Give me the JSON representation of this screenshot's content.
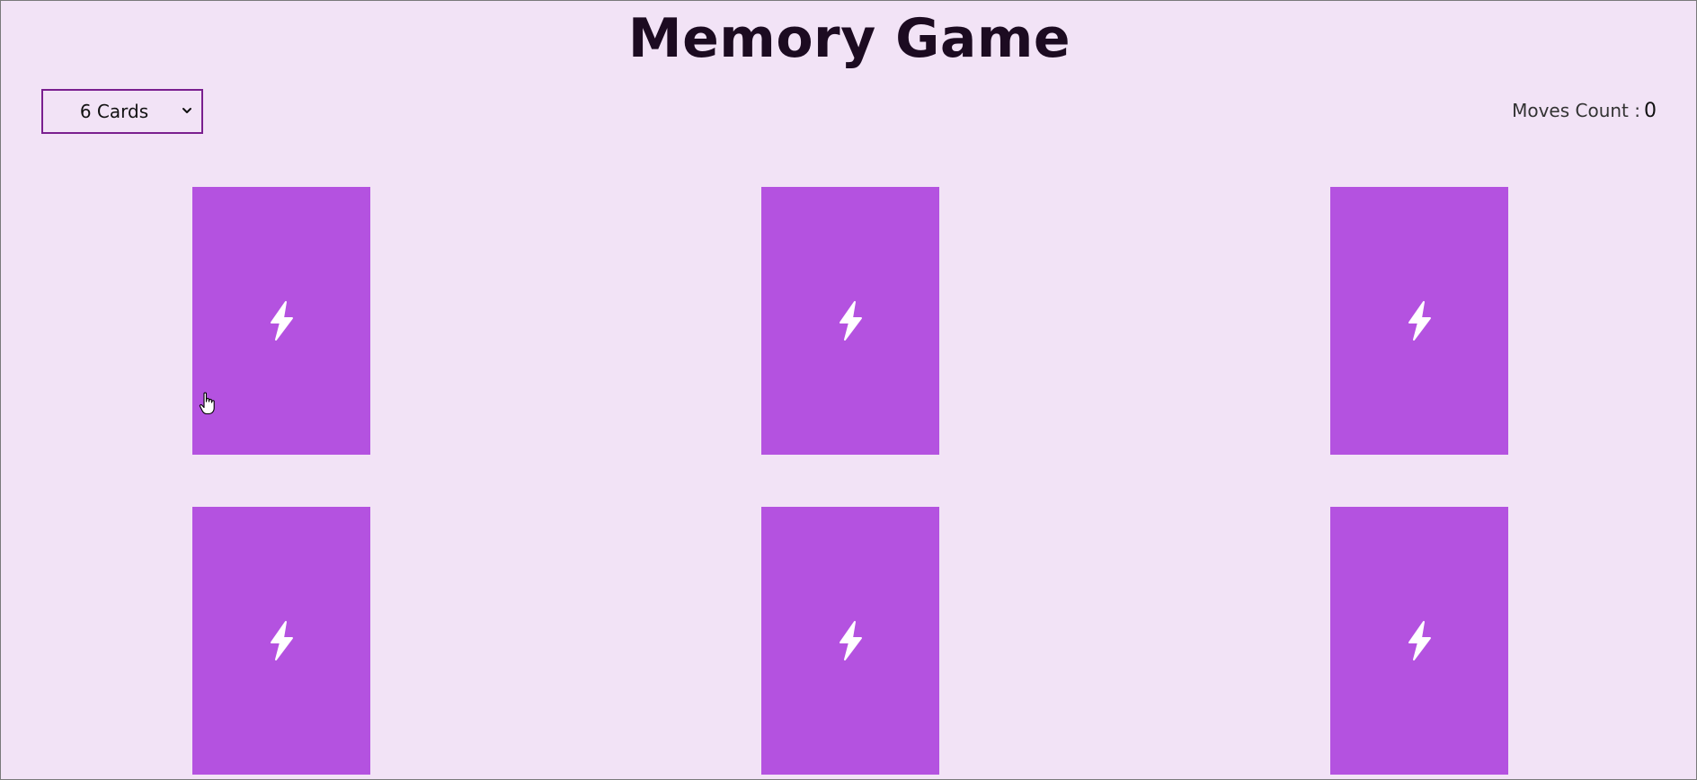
{
  "title": "Memory Game",
  "card_count_select": {
    "selected": "6 Cards"
  },
  "moves": {
    "label": "Moves Count :",
    "value": "0"
  },
  "cards": [
    {
      "state": "face-down",
      "icon": "lightning-bolt-icon"
    },
    {
      "state": "face-down",
      "icon": "lightning-bolt-icon"
    },
    {
      "state": "face-down",
      "icon": "lightning-bolt-icon"
    },
    {
      "state": "face-down",
      "icon": "lightning-bolt-icon"
    },
    {
      "state": "face-down",
      "icon": "lightning-bolt-icon"
    },
    {
      "state": "face-down",
      "icon": "lightning-bolt-icon"
    }
  ],
  "colors": {
    "background": "#f2e3f6",
    "card": "#b452e0",
    "select_border": "#7a1f8f",
    "title": "#1c0b21"
  }
}
